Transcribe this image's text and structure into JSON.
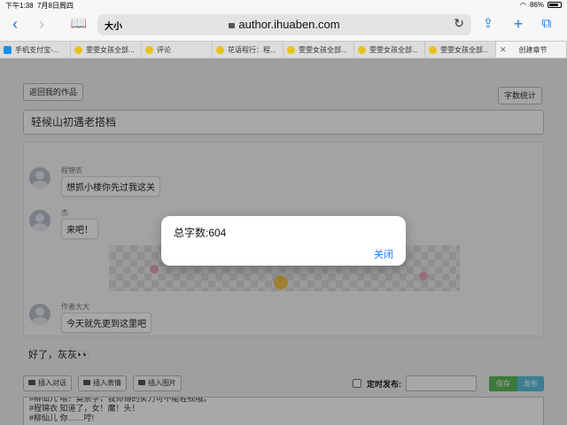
{
  "status_bar": {
    "time": "下午1:38",
    "date": "7月8日周四",
    "battery": "86%",
    "battery_level": 0.86
  },
  "browser": {
    "address_aa": "大小",
    "url": "author.ihuaben.com",
    "tabs": [
      {
        "label": "手机支付宝-...",
        "icon": "alipay-icon"
      },
      {
        "label": "雯雯女孩全部...",
        "icon": "huaben-icon"
      },
      {
        "label": "评论",
        "icon": "huaben-icon"
      },
      {
        "label": "花语程行：程...",
        "icon": "huaben-icon"
      },
      {
        "label": "雯雯女孩全部...",
        "icon": "huaben-icon"
      },
      {
        "label": "雯雯女孩全部...",
        "icon": "huaben-icon"
      },
      {
        "label": "雯雯女孩全部...",
        "icon": "huaben-icon"
      },
      {
        "label": "创建章节",
        "icon": "close-icon"
      }
    ]
  },
  "page": {
    "back_label": "返回我的作品",
    "word_count_label": "字数统计",
    "chapter_title": "轻候山初遇老搭档",
    "messages": [
      {
        "speaker": "程锦衣",
        "text": "想抓小楼你先过我这关"
      },
      {
        "speaker": "杰",
        "text": "来吧！"
      },
      {
        "speaker": "作者大大",
        "text": "今天就先更到这里吧"
      }
    ],
    "narration": "好了，灰灰👀",
    "toolbar": {
      "insert_dialog": "插入对话",
      "insert_emoji": "插入表情",
      "insert_image": "插入图片",
      "schedule_label": "定时发布:",
      "save": "保存",
      "publish": "发布"
    },
    "editor_lines": [
      "#柳仙儿 喂！莫崇学，我师傅的实力可不能轻视哦。",
      "#程锦衣 知道了，女！魔！头！",
      "#柳仙儿 你……哼!"
    ]
  },
  "dialog": {
    "message": "总字数:604",
    "close_label": "关闭"
  }
}
